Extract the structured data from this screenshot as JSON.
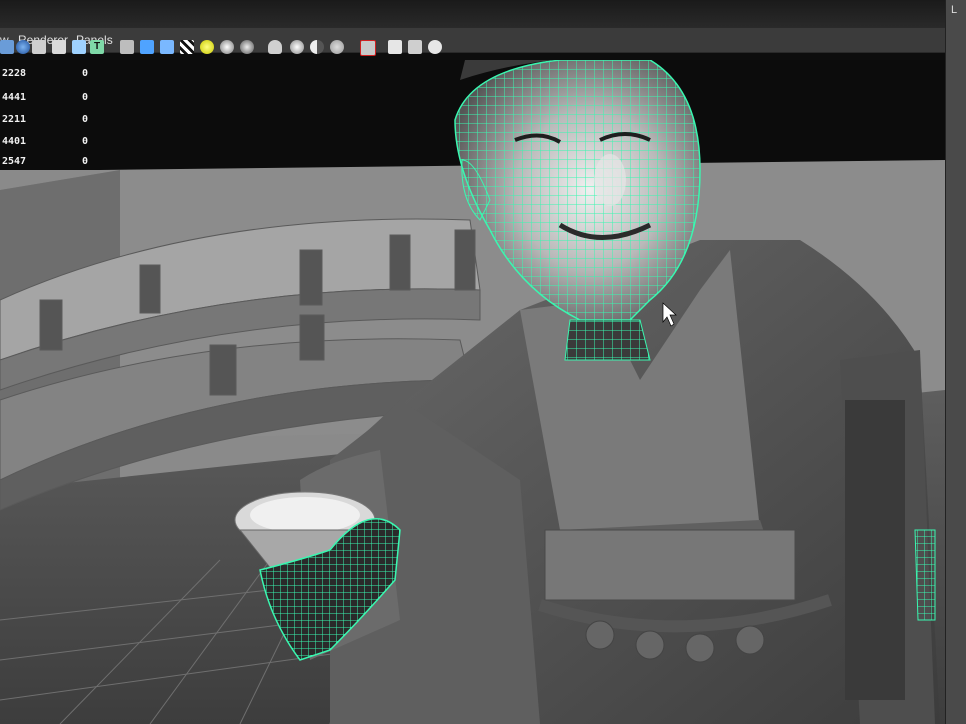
{
  "menu": {
    "items": [
      {
        "label": "w"
      },
      {
        "label": "Renderer"
      },
      {
        "label": "Panels"
      }
    ]
  },
  "toolbar": {
    "icons": [
      "camera-icon",
      "shade-icon",
      "render-sphere-icon",
      "wireframe-icon",
      "isolate-icon",
      "xray-icon",
      "text-icon",
      "cube-icon",
      "cube-solid-icon",
      "checker-icon",
      "light-bulb-icon",
      "sphere-icon",
      "sphere-shaded-icon",
      "bust-icon",
      "sphere-lit-icon",
      "sphere-half-icon",
      "sphere-flat-icon",
      "select-arrow-icon",
      "cube-outline-icon",
      "cube-stack-icon",
      "share-nodes-icon"
    ]
  },
  "right_panel": {
    "tab_label": "L"
  },
  "hud": {
    "rows": [
      {
        "value": "2228",
        "delta": "0"
      },
      {
        "value": "4441",
        "delta": "0"
      },
      {
        "value": "2211",
        "delta": "0"
      },
      {
        "value": "4401",
        "delta": "0"
      },
      {
        "value": "2547",
        "delta": "0"
      }
    ]
  },
  "colors": {
    "wireframe": "#3af7b0",
    "background": "#8a8a8a",
    "mesh_dark": "#4f4f4f"
  }
}
